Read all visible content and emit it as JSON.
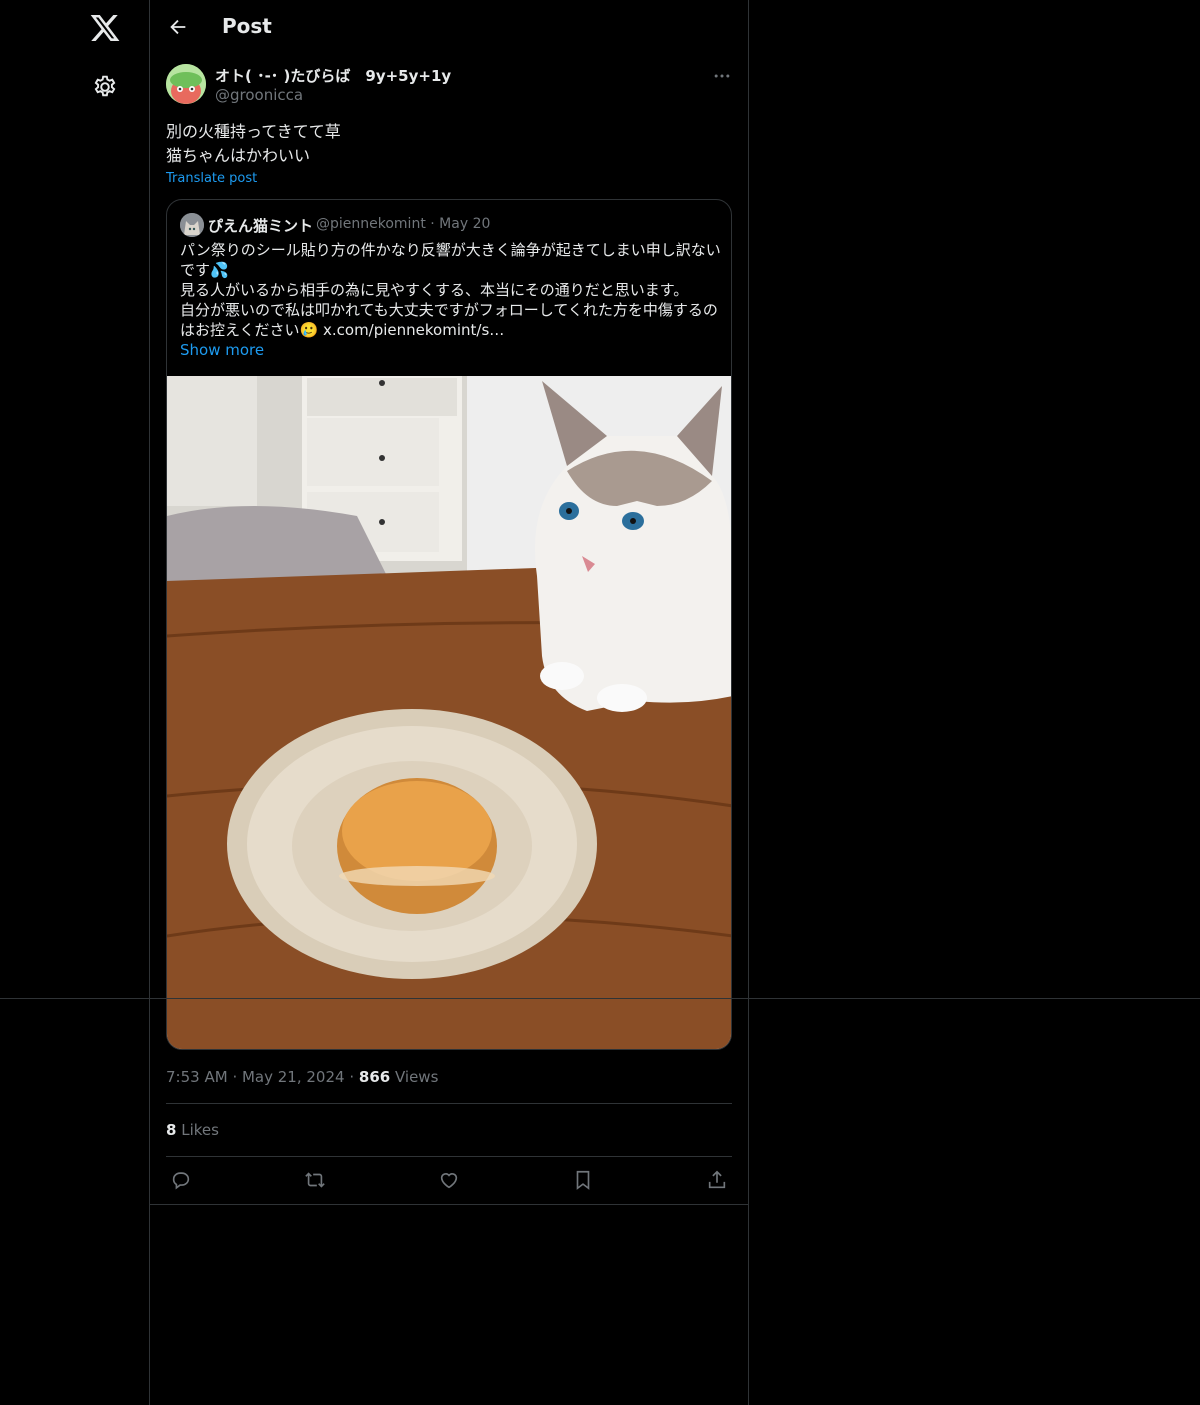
{
  "header": {
    "title": "Post"
  },
  "icons": [
    "x-logo-icon",
    "gear-icon",
    "back-arrow-icon",
    "more-icon",
    "reply-icon",
    "repost-icon",
    "like-icon",
    "bookmark-icon",
    "share-icon"
  ],
  "post": {
    "display_name": "オト( ･-･ )たびらば　9y+5y+1y",
    "handle": "@groonicca",
    "text_line1": "別の火種持ってきてて草",
    "text_line2": "猫ちゃんはかわいい",
    "translate": "Translate post",
    "time": "7:53 AM",
    "date": "May 21, 2024",
    "views_count": "866",
    "views_label": "Views",
    "likes_count": "8",
    "likes_label": "Likes"
  },
  "quote": {
    "display_name": "ぴえん猫ミント",
    "handle": "@piennekomint",
    "date": "May 20",
    "line1": "パン祭りのシール貼り方の件かなり反響が大きく論争が起きてしまい申し訳ないです💦",
    "line2": "見る人がいるから相手の為に見やすくする、本当にその通りだと思います。",
    "line3": "自分が悪いので私は叩かれても大丈夫ですがフォローしてくれた方を中傷するのはお控えください🥲 x.com/piennekomint/s…",
    "show_more": "Show more"
  },
  "colors": {
    "accent": "#1d9bf0",
    "muted": "#71767b",
    "border": "#2f3336",
    "text": "#e7e9ea"
  }
}
